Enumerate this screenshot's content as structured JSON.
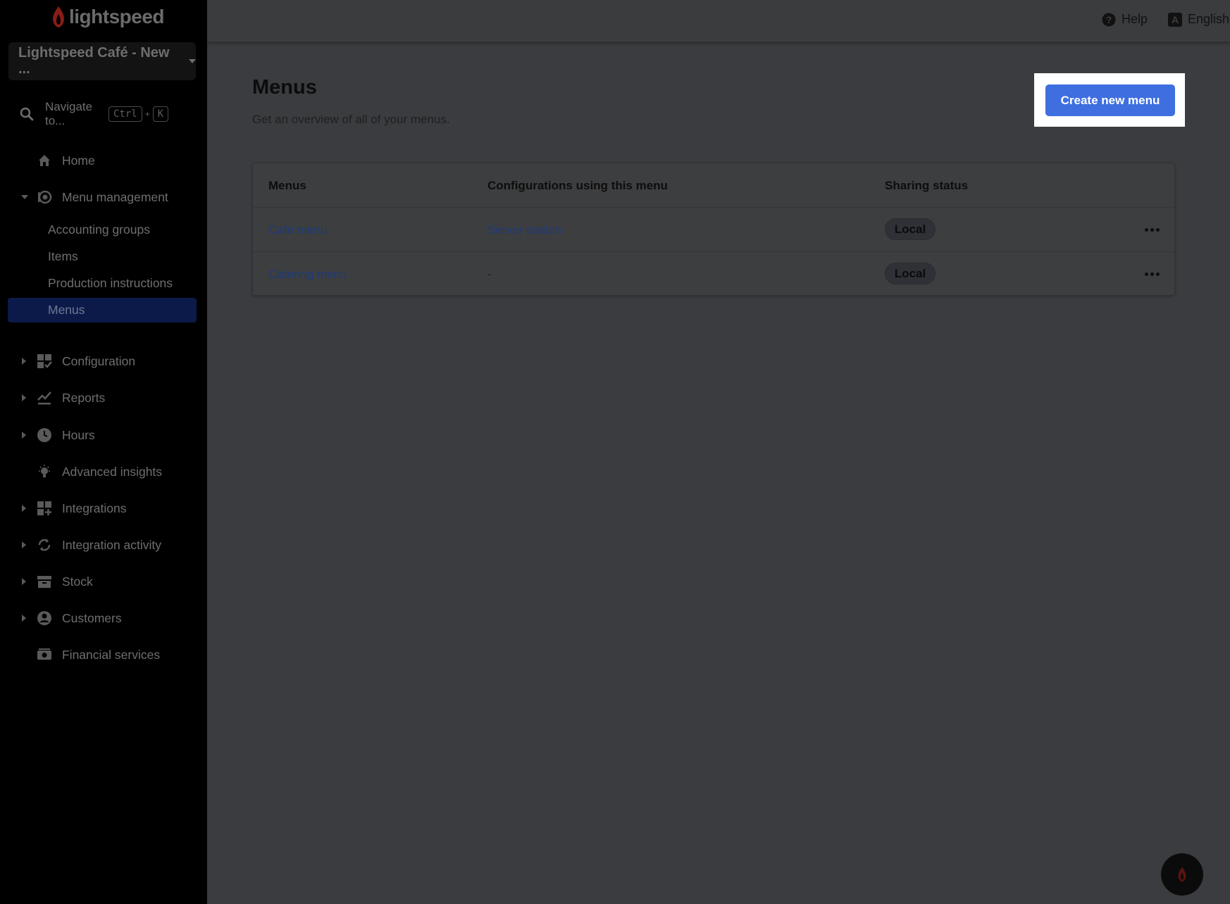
{
  "brand": {
    "logo_text": "lightspeed",
    "accent": "#3f6ee0",
    "flame_color": "#8a1c16"
  },
  "sidebar": {
    "store_name": "Lightspeed Café - New ...",
    "search": {
      "label": "Navigate to...",
      "shortcut_key1": "Ctrl",
      "shortcut_plus": "+",
      "shortcut_key2": "K"
    },
    "items": [
      {
        "label": "Home",
        "icon": "home-icon"
      },
      {
        "label": "Menu management",
        "icon": "menu-management-icon",
        "expanded": true
      },
      {
        "label": "Configuration",
        "icon": "configuration-icon"
      },
      {
        "label": "Reports",
        "icon": "reports-icon"
      },
      {
        "label": "Hours",
        "icon": "clock-icon"
      },
      {
        "label": "Advanced insights",
        "icon": "lightbulb-icon"
      },
      {
        "label": "Integrations",
        "icon": "integrations-icon"
      },
      {
        "label": "Integration activity",
        "icon": "sync-icon"
      },
      {
        "label": "Stock",
        "icon": "stock-icon"
      },
      {
        "label": "Customers",
        "icon": "customer-icon"
      },
      {
        "label": "Financial services",
        "icon": "financial-icon"
      }
    ],
    "sub_items": [
      {
        "label": "Accounting groups"
      },
      {
        "label": "Items"
      },
      {
        "label": "Production instructions"
      },
      {
        "label": "Menus",
        "active": true
      }
    ]
  },
  "topbar": {
    "help_label": "Help",
    "language_label": "English",
    "lang_icon_letter": "A"
  },
  "main": {
    "title": "Menus",
    "subtitle": "Get an overview of all of your menus.",
    "create_button": "Create new menu",
    "table": {
      "headers": [
        "Menus",
        "Configurations using this menu",
        "Sharing status"
      ],
      "rows": [
        {
          "menu": "Café menu",
          "configuration": "Server station",
          "status": "Local"
        },
        {
          "menu": "Catering menu",
          "configuration": "-",
          "status": "Local"
        }
      ]
    }
  }
}
